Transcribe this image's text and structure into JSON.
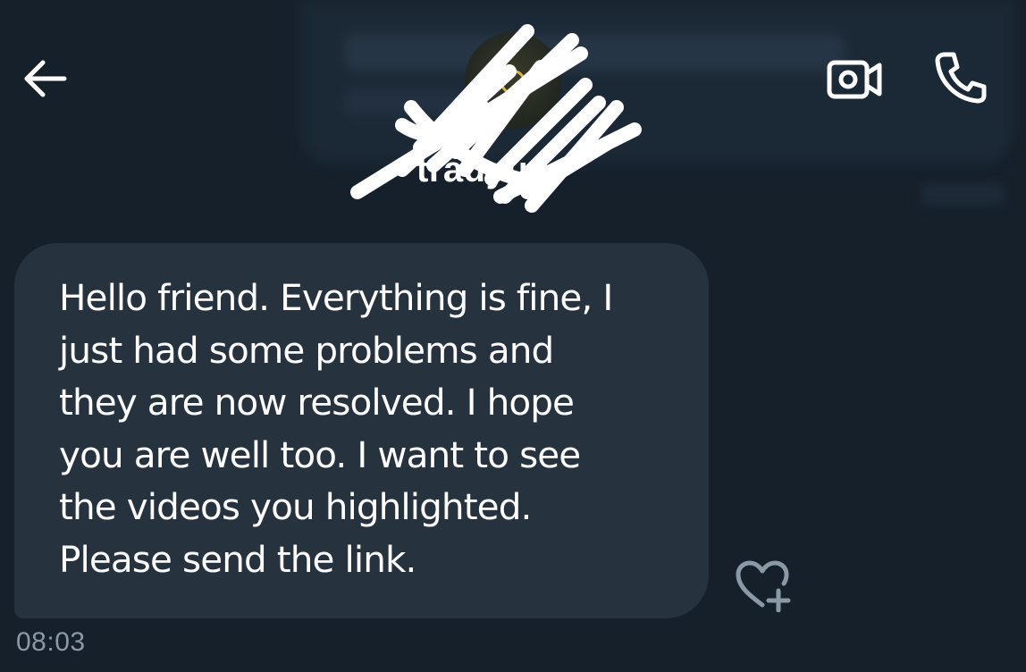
{
  "header": {
    "contact_name": "tradyun",
    "back_icon": "arrow-left-icon",
    "video_icon": "video-camera-icon",
    "call_icon": "phone-icon"
  },
  "message": {
    "text": "Hello friend. Everything is fine, I\njust had some problems and\nthey are now resolved. I hope\nyou are well too. I want to see\nthe videos you highlighted.\nPlease send the link.",
    "timestamp": "08:03",
    "react_icon": "heart-plus-icon"
  },
  "colors": {
    "background": "#16202b",
    "bubble": "#27323f",
    "timestamp": "#8b98a5",
    "icon": "#ffffff",
    "react_icon": "#8b98a5"
  }
}
